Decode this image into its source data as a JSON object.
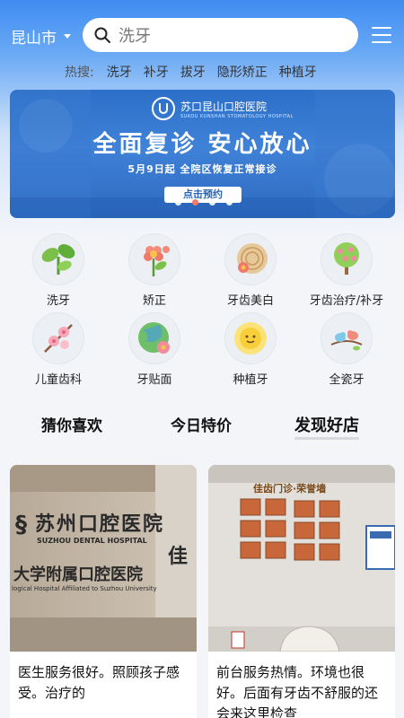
{
  "header": {
    "city": "昆山市",
    "search_placeholder": "洗牙"
  },
  "hot_search": {
    "label": "热搜:",
    "items": [
      "洗牙",
      "补牙",
      "拔牙",
      "隐形矫正",
      "种植牙"
    ]
  },
  "banner": {
    "logo_cn": "苏口昆山口腔医院",
    "logo_en": "SUKOU KUNSHAN STOMATOLOGY HOSPITAL",
    "headline": "全面复诊 安心放心",
    "subline": "5月9日起 全院区恢复正常接诊",
    "cta": "点击预约",
    "active_dot": 1,
    "dot_count": 4
  },
  "categories": [
    {
      "label": "洗牙",
      "icon": "plant-sprout-icon"
    },
    {
      "label": "矫正",
      "icon": "flower-icon"
    },
    {
      "label": "牙齿美白",
      "icon": "wood-rings-flower-icon"
    },
    {
      "label": "牙齿治疗/补牙",
      "icon": "blossom-tree-icon"
    },
    {
      "label": "儿童齿科",
      "icon": "cherry-blossom-icon"
    },
    {
      "label": "牙贴面",
      "icon": "globe-flower-icon"
    },
    {
      "label": "种植牙",
      "icon": "sun-face-icon"
    },
    {
      "label": "全瓷牙",
      "icon": "birds-branch-icon"
    }
  ],
  "tabs": [
    "猜你喜欢",
    "今日特价",
    "发现好店"
  ],
  "active_tab": 2,
  "cards": [
    {
      "image": "suzhou-dental-hospital-sign",
      "sign_line1": "苏州口腔医院",
      "sign_line2": "SUZHOU DENTAL HOSPITAL",
      "sign_line3": "大学附属口腔医院",
      "sign_line4": "logical Hospital Affiliated to Suzhou University",
      "sign_side": "佳",
      "text": "医生服务很好。照顾孩子感受。治疗的"
    },
    {
      "image": "clinic-honor-wall",
      "wall_title": "佳齿门诊·荣誉墙",
      "text": "前台服务热情。环境也很好。后面有牙齿不舒服的还会来这里检查"
    }
  ],
  "colors": {
    "brand_blue": "#3f8df2",
    "banner_blue": "#2c6fc9",
    "active_dot": "#f07a6a"
  }
}
